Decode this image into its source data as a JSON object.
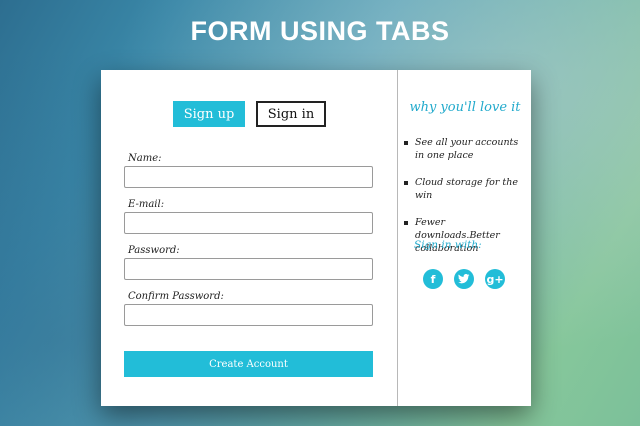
{
  "page": {
    "title": "FORM USING TABS"
  },
  "tabs": {
    "signup_label": "Sign up",
    "signin_label": "Sign in",
    "active": "Sign up"
  },
  "form": {
    "fields": [
      {
        "label": "Name:",
        "value": ""
      },
      {
        "label": "E-mail:",
        "value": ""
      },
      {
        "label": "Password:",
        "value": ""
      },
      {
        "label": "Confirm Password:",
        "value": ""
      }
    ],
    "submit_label": "Create Account"
  },
  "info": {
    "heading": "why you'll love it",
    "benefits": [
      "See all your accounts in one place",
      "Cloud storage for the win",
      "Fewer downloads.Better collaboration"
    ],
    "signin_with": "Sign in with:",
    "social_icons": [
      "facebook-icon",
      "twitter-icon",
      "google-plus-icon"
    ]
  },
  "colors": {
    "accent": "#22bdd8",
    "heading_accent": "#22aacc",
    "card_bg": "#ffffff"
  }
}
